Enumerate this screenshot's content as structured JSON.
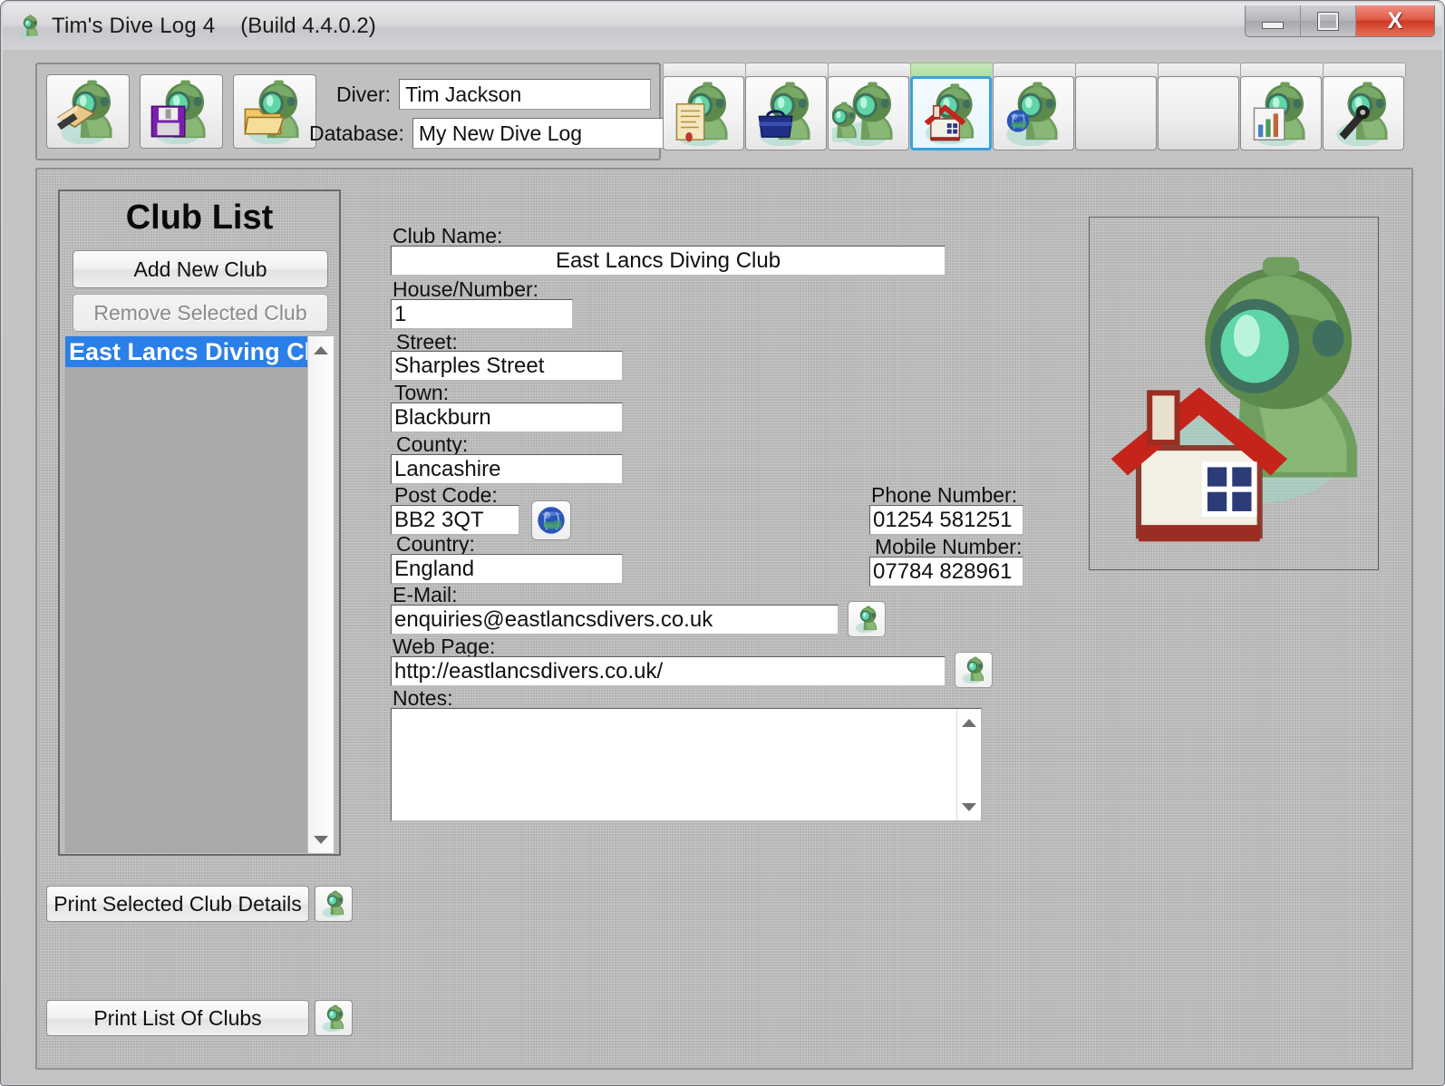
{
  "window": {
    "title": "Tim's Dive Log 4",
    "build": "(Build 4.4.0.2)",
    "app_icon": "diver-icon",
    "controls": {
      "minimize": "minimize-icon",
      "maximize": "maximize-icon",
      "close": "X"
    }
  },
  "toolbar": {
    "buttons": [
      {
        "name": "new-log-button",
        "icon": "diver-with-book-icon"
      },
      {
        "name": "save-log-button",
        "icon": "diver-with-floppy-icon"
      },
      {
        "name": "open-log-button",
        "icon": "diver-with-folder-icon"
      }
    ],
    "diver_label": "Diver:",
    "diver_value": "Tim Jackson",
    "database_label": "Database:",
    "database_value": "My New Dive Log"
  },
  "nav": {
    "items": [
      {
        "name": "nav-logbook",
        "icon": "diver-with-certificate-icon",
        "active": false,
        "empty": false
      },
      {
        "name": "nav-equipment",
        "icon": "diver-with-bag-icon",
        "active": false,
        "empty": false
      },
      {
        "name": "nav-buddies",
        "icon": "diver-with-buddy-icon",
        "active": false,
        "empty": false
      },
      {
        "name": "nav-clubs",
        "icon": "diver-with-house-icon",
        "active": true,
        "empty": false
      },
      {
        "name": "nav-locations",
        "icon": "diver-with-globe-icon",
        "active": false,
        "empty": false
      },
      {
        "name": "nav-blank-1",
        "icon": "blank-icon",
        "active": false,
        "empty": true
      },
      {
        "name": "nav-blank-2",
        "icon": "blank-icon",
        "active": false,
        "empty": true
      },
      {
        "name": "nav-statistics",
        "icon": "diver-with-chart-icon",
        "active": false,
        "empty": false
      },
      {
        "name": "nav-tools",
        "icon": "diver-with-tool-icon",
        "active": false,
        "empty": false
      }
    ]
  },
  "club_list": {
    "title": "Club List",
    "add_button": "Add New Club",
    "remove_button": "Remove Selected Club",
    "remove_enabled": false,
    "items": [
      {
        "label": "East Lancs Diving Club",
        "selected": true
      }
    ],
    "print_club_details_button": "Print Selected Club Details",
    "print_list_button": "Print List Of Clubs",
    "print_icon": "diver-printer-icon"
  },
  "form": {
    "club_name_label": "Club Name:",
    "club_name_value": "East Lancs Diving Club",
    "house_label": "House/Number:",
    "house_value": "1",
    "street_label": "Street:",
    "street_value": "Sharples Street",
    "town_label": "Town:",
    "town_value": "Blackburn",
    "county_label": "County:",
    "county_value": "Lancashire",
    "postcode_label": "Post Code:",
    "postcode_value": "BB2 3QT",
    "postcode_map_icon": "globe-icon",
    "country_label": "Country:",
    "country_value": "England",
    "phone_label": "Phone Number:",
    "phone_value": "01254 581251",
    "mobile_label": "Mobile Number:",
    "mobile_value": "07784 828961",
    "email_label": "E-Mail:",
    "email_value": "enquiries@eastlancsdivers.co.uk",
    "email_icon": "diver-mail-icon",
    "webpage_label": "Web Page:",
    "webpage_value": "http://eastlancsdivers.co.uk/",
    "webpage_icon": "diver-web-icon",
    "notes_label": "Notes:",
    "notes_value": ""
  },
  "image_panel": {
    "icon": "diver-with-house-large-icon"
  },
  "colors": {
    "accent_selection": "#2a7fe8",
    "active_tab": "#aedfa0",
    "close_button": "#cf3a24",
    "window_bg": "#c3c3c3",
    "panel_bg": "#bcbcbc",
    "list_bg": "#a9a9a9"
  }
}
